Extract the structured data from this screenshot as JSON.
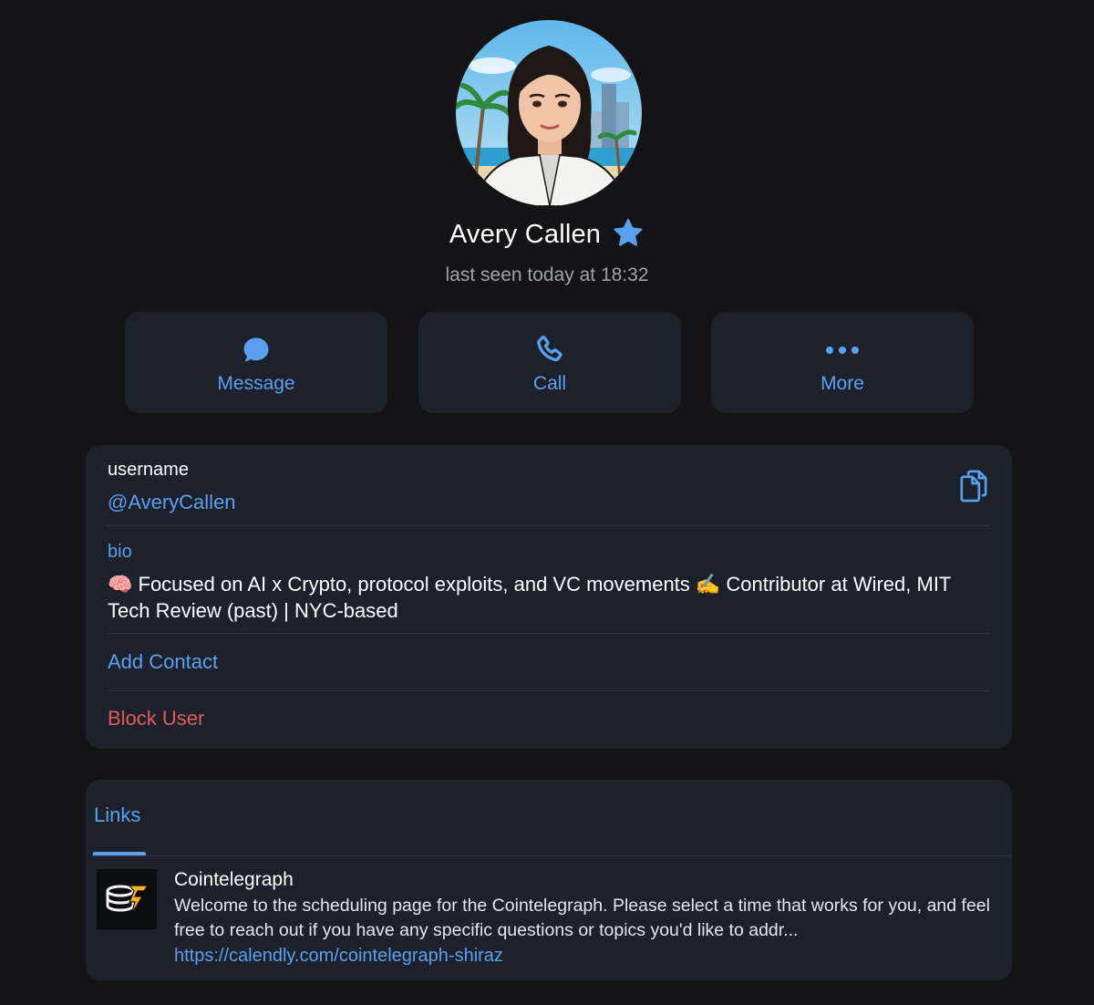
{
  "profile": {
    "name": "Avery Callen",
    "status": "last seen today at 18:32",
    "verified_icon": "star-badge-icon",
    "accent_color": "#5aa0ee"
  },
  "actions": {
    "message_label": "Message",
    "call_label": "Call",
    "more_label": "More"
  },
  "info": {
    "username_label": "username",
    "username_value": "@AveryCallen",
    "bio_label": "bio",
    "bio_text": "🧠 Focused on AI x Crypto, protocol exploits, and VC movements ✍️ Contributor at Wired, MIT Tech Review (past) | NYC-based",
    "add_contact_label": "Add Contact",
    "block_user_label": "Block User",
    "danger_color": "#e05c5c"
  },
  "links": {
    "tab_label": "Links",
    "items": [
      {
        "title": "Cointelegraph",
        "description": "Welcome to the scheduling page for the Cointelegraph. Please select a time that works for you, and feel free to reach out if you have any specific questions or topics you'd like to addr...",
        "url": "https://calendly.com/cointelegraph-shiraz"
      }
    ]
  }
}
